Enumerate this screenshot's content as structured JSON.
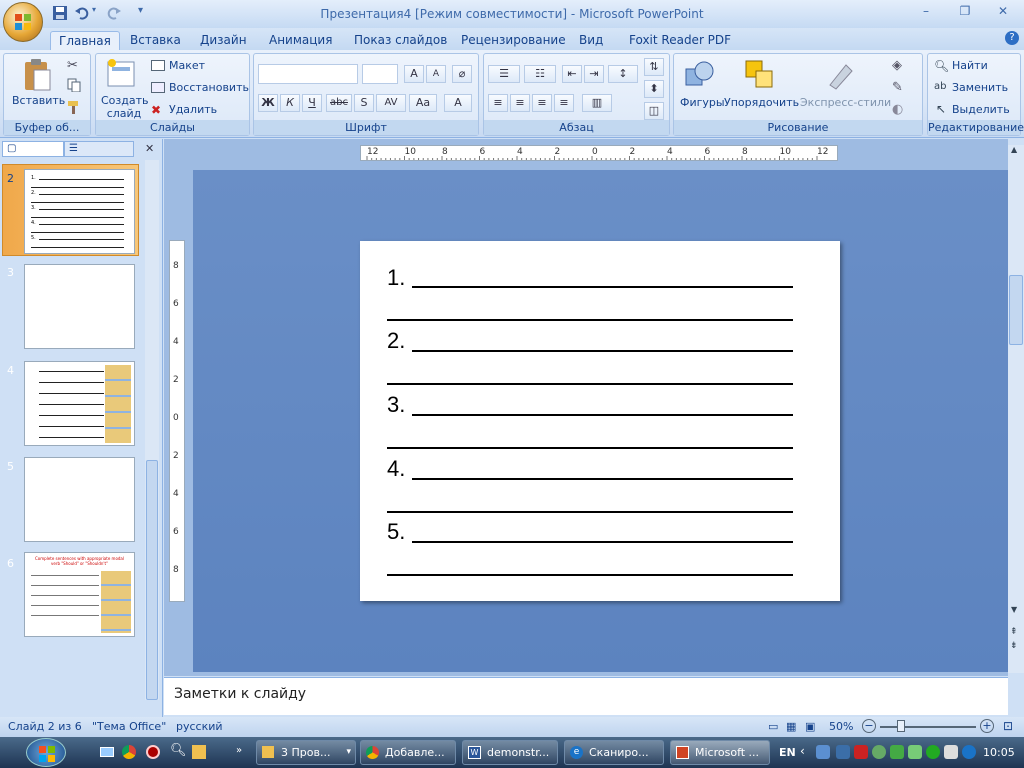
{
  "titlebar": {
    "title": "Презентация4 [Режим совместимости] - Microsoft PowerPoint"
  },
  "tabs": [
    "Главная",
    "Вставка",
    "Дизайн",
    "Анимация",
    "Показ слайдов",
    "Рецензирование",
    "Вид",
    "Foxit Reader PDF"
  ],
  "ribbon": {
    "clipboard": {
      "paste": "Вставить",
      "label": "Буфер об..."
    },
    "slides": {
      "new_slide": "Создать слайд",
      "layout": "Макет",
      "reset": "Восстановить",
      "delete": "Удалить",
      "label": "Слайды"
    },
    "font": {
      "label": "Шрифт",
      "bold": "Ж",
      "italic": "К",
      "underline": "Ч",
      "strike": "abc",
      "shadow": "S",
      "spacing": "AV",
      "case": "Aa",
      "color": "A"
    },
    "paragraph": {
      "label": "Абзац"
    },
    "drawing": {
      "shapes": "Фигуры",
      "arrange": "Упорядочить",
      "quick_styles": "Экспресс-стили",
      "label": "Рисование"
    },
    "editing": {
      "find": "Найти",
      "replace": "Заменить",
      "select": "Выделить",
      "label": "Редактирование"
    }
  },
  "thumbnails": [
    {
      "num": "2",
      "kind": "lines"
    },
    {
      "num": "3",
      "kind": "blank"
    },
    {
      "num": "4",
      "kind": "lines-images"
    },
    {
      "num": "5",
      "kind": "blank"
    },
    {
      "num": "6",
      "kind": "text-images",
      "heading": "Complete sentences with appropriate modal verb \"Should\" or \"Shouldn't\""
    }
  ],
  "ruler": {
    "h_ticks": [
      "12",
      "10",
      "8",
      "6",
      "4",
      "2",
      "0",
      "2",
      "4",
      "6",
      "8",
      "10",
      "12"
    ],
    "v_ticks": [
      "8",
      "6",
      "4",
      "2",
      "0",
      "2",
      "4",
      "6",
      "8"
    ]
  },
  "slide": {
    "items": [
      "1.",
      "2.",
      "3.",
      "4.",
      "5."
    ]
  },
  "notes": {
    "placeholder": "Заметки к слайду"
  },
  "status": {
    "slide": "Слайд 2 из 6",
    "theme": "\"Тема Office\"",
    "lang": "русский",
    "zoom": "50%"
  },
  "taskbar": {
    "items": [
      "3 Пров...",
      "Добавле...",
      "demonstr...",
      "Сканиро...",
      "Microsoft ..."
    ],
    "lang": "EN",
    "time": "10:05"
  },
  "colors": {
    "accent": "#15428b",
    "canvas": "#6a8fc7",
    "selected_thumb": "#f0a84a"
  }
}
